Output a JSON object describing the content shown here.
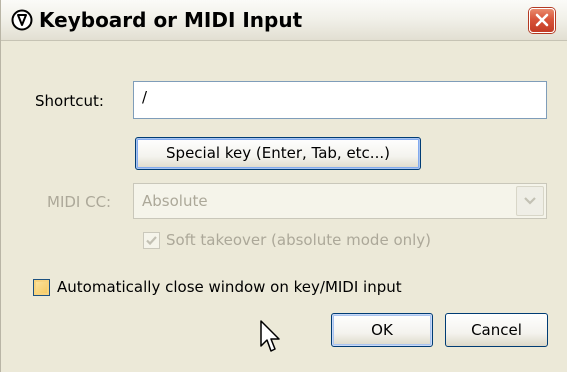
{
  "window": {
    "title": "Keyboard or MIDI Input",
    "close_icon": "close-icon"
  },
  "shortcut": {
    "label": "Shortcut:",
    "value": "/"
  },
  "special_key_button": "Special key (Enter, Tab, etc...)",
  "midi_cc": {
    "label": "MIDI CC:",
    "selected": "Absolute",
    "disabled": true
  },
  "soft_takeover": {
    "label": "Soft takeover (absolute mode only)",
    "checked": true,
    "disabled": true
  },
  "auto_close": {
    "label": "Automatically close window on key/MIDI input",
    "checked": false
  },
  "buttons": {
    "ok": "OK",
    "cancel": "Cancel"
  },
  "colors": {
    "title_bar": "#f2f1ea",
    "dialog_bg": "#ece9d8",
    "close_red": "#d8543a",
    "button_border": "#003c74",
    "disabled_text": "#aca899"
  }
}
